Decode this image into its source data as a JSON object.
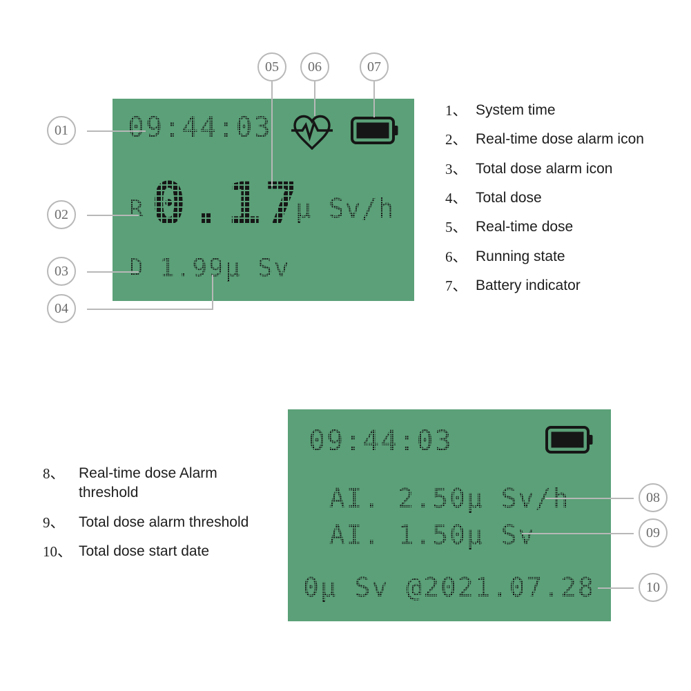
{
  "colors": {
    "lcd_background": "#5ba078",
    "lcd_foreground": "#161616",
    "callout_outline": "#b8b8b8",
    "callout_text": "#6b6b6b",
    "legend_text": "#1d1d1d",
    "page_background": "#ffffff"
  },
  "screen_top": {
    "name": "measurement-screen",
    "time": "09:44:03",
    "realtime_label": "R",
    "realtime_value": "0.17",
    "realtime_unit": "μ Sv/h",
    "total_label": "D",
    "total_value": "1.99μ Sv",
    "running_state_icon": "heart-pulse-icon",
    "battery_icon": "battery-full-icon"
  },
  "screen_bottom": {
    "name": "threshold-screen",
    "time": "09:44:03",
    "alarm_rate_threshold": "AI. 2.50μ Sv/h",
    "alarm_dose_threshold": "AI. 1.50μ Sv",
    "total_dose_start": "0μ Sv @2021.07.28",
    "battery_icon": "battery-full-icon"
  },
  "callouts": [
    {
      "id": "01",
      "label": "01"
    },
    {
      "id": "02",
      "label": "02"
    },
    {
      "id": "03",
      "label": "03"
    },
    {
      "id": "04",
      "label": "04"
    },
    {
      "id": "05",
      "label": "05"
    },
    {
      "id": "06",
      "label": "06"
    },
    {
      "id": "07",
      "label": "07"
    },
    {
      "id": "08",
      "label": "08"
    },
    {
      "id": "09",
      "label": "09"
    },
    {
      "id": "10",
      "label": "10"
    }
  ],
  "legend_top": [
    {
      "num": "1、",
      "label": "System time"
    },
    {
      "num": "2、",
      "label": "Real-time dose alarm icon"
    },
    {
      "num": "3、",
      "label": "Total dose alarm icon"
    },
    {
      "num": "4、",
      "label": "Total dose"
    },
    {
      "num": "5、",
      "label": "Real-time dose"
    },
    {
      "num": "6、",
      "label": "Running state"
    },
    {
      "num": "7、",
      "label": "Battery indicator"
    }
  ],
  "legend_bottom": [
    {
      "num": "8、",
      "label": "Real-time dose Alarm threshold"
    },
    {
      "num": "9、",
      "label": "Total dose alarm threshold"
    },
    {
      "num": "10、",
      "label": "Total dose start date"
    }
  ]
}
